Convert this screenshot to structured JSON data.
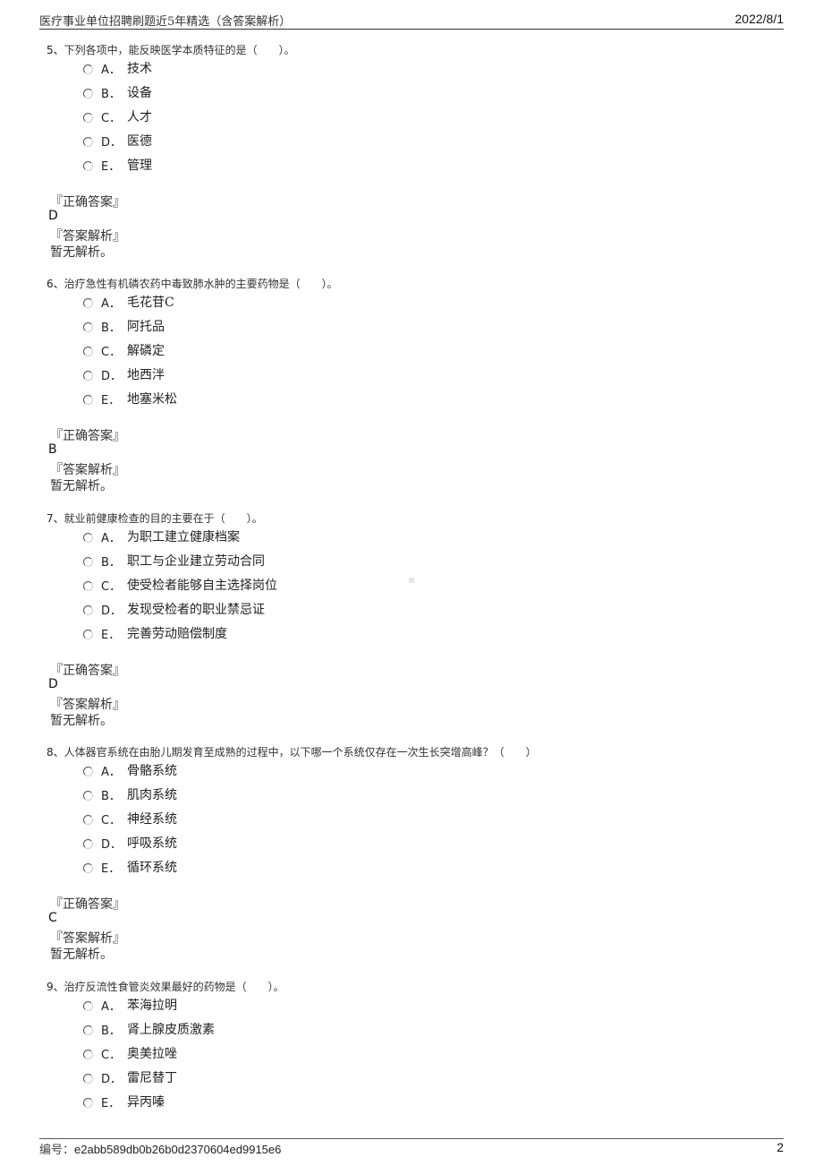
{
  "header": {
    "title": "医疗事业单位招聘刷题近5年精选（含答案解析）",
    "date": "2022/8/1"
  },
  "labels": {
    "correct_answer": "『正确答案』",
    "analysis": "『答案解析』"
  },
  "questions": [
    {
      "number": "5、",
      "text": "下列各项中，能反映医学本质特征的是（　　）。",
      "options": [
        {
          "letter": "A．",
          "text": "技术"
        },
        {
          "letter": "B．",
          "text": "设备"
        },
        {
          "letter": "C．",
          "text": "人才"
        },
        {
          "letter": "D．",
          "text": "医德"
        },
        {
          "letter": "E．",
          "text": "管理"
        }
      ],
      "answer": "D",
      "analysis": "暂无解析。"
    },
    {
      "number": "6、",
      "text": "治疗急性有机磷农药中毒致肺水肿的主要药物是（　　）。",
      "options": [
        {
          "letter": "A．",
          "text": "毛花苷C"
        },
        {
          "letter": "B．",
          "text": "阿托品"
        },
        {
          "letter": "C．",
          "text": "解磷定"
        },
        {
          "letter": "D．",
          "text": "地西泮"
        },
        {
          "letter": "E．",
          "text": "地塞米松"
        }
      ],
      "answer": "B",
      "analysis": "暂无解析。"
    },
    {
      "number": "7、",
      "text": "就业前健康检查的目的主要在于（　　）。",
      "options": [
        {
          "letter": "A．",
          "text": "为职工建立健康档案"
        },
        {
          "letter": "B．",
          "text": "职工与企业建立劳动合同"
        },
        {
          "letter": "C．",
          "text": "使受检者能够自主选择岗位"
        },
        {
          "letter": "D．",
          "text": "发现受检者的职业禁忌证"
        },
        {
          "letter": "E．",
          "text": "完善劳动赔偿制度"
        }
      ],
      "answer": "D",
      "analysis": "暂无解析。"
    },
    {
      "number": "8、",
      "text": "人体器官系统在由胎儿期发育至成熟的过程中，以下哪一个系统仅存在一次生长突增高峰？（　　）",
      "options": [
        {
          "letter": "A．",
          "text": "骨骼系统"
        },
        {
          "letter": "B．",
          "text": "肌肉系统"
        },
        {
          "letter": "C．",
          "text": "神经系统"
        },
        {
          "letter": "D．",
          "text": "呼吸系统"
        },
        {
          "letter": "E．",
          "text": "循环系统"
        }
      ],
      "answer": "C",
      "analysis": "暂无解析。"
    },
    {
      "number": "9、",
      "text": "治疗反流性食管炎效果最好的药物是（　　）。",
      "options": [
        {
          "letter": "A．",
          "text": "苯海拉明"
        },
        {
          "letter": "B．",
          "text": "肾上腺皮质激素"
        },
        {
          "letter": "C．",
          "text": "奥美拉唑"
        },
        {
          "letter": "D．",
          "text": "雷尼替丁"
        },
        {
          "letter": "E．",
          "text": "异丙嗪"
        }
      ]
    }
  ],
  "footer": {
    "id_label": "编号：",
    "id_value": "e2abb589db0b26b0d2370604ed9915e6",
    "page": "2"
  }
}
